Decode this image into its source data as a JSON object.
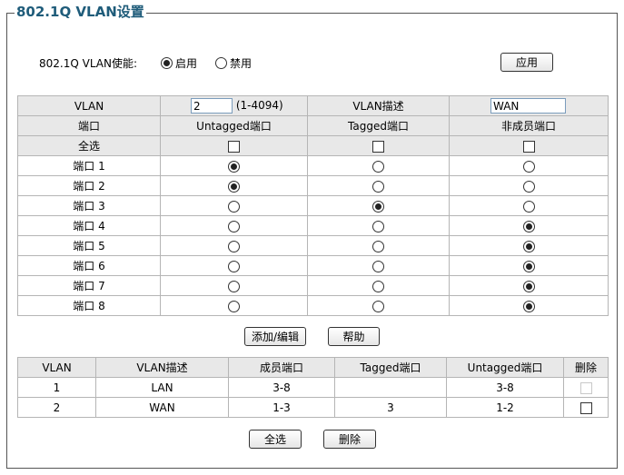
{
  "title": "802.1Q VLAN设置",
  "enable": {
    "label": "802.1Q VLAN使能:",
    "on_label": "启用",
    "off_label": "禁用",
    "selected": "on"
  },
  "apply_label": "应用",
  "config": {
    "vlan_label": "VLAN",
    "vlan_value": "2",
    "vlan_range": "(1-4094)",
    "desc_label": "VLAN描述",
    "desc_value": "WAN",
    "headers": [
      "端口",
      "Untagged端口",
      "Tagged端口",
      "非成员端口"
    ],
    "select_all_label": "全选",
    "ports": [
      {
        "name": "端口 1",
        "mode": "untagged"
      },
      {
        "name": "端口 2",
        "mode": "untagged"
      },
      {
        "name": "端口 3",
        "mode": "tagged"
      },
      {
        "name": "端口 4",
        "mode": "nonmember"
      },
      {
        "name": "端口 5",
        "mode": "nonmember"
      },
      {
        "name": "端口 6",
        "mode": "nonmember"
      },
      {
        "name": "端口 7",
        "mode": "nonmember"
      },
      {
        "name": "端口 8",
        "mode": "nonmember"
      }
    ]
  },
  "add_edit_label": "添加/编辑",
  "help_label": "帮助",
  "list": {
    "headers": [
      "VLAN",
      "VLAN描述",
      "成员端口",
      "Tagged端口",
      "Untagged端口",
      "删除"
    ],
    "rows": [
      {
        "vlan": "1",
        "desc": "LAN",
        "members": "3-8",
        "tagged": "",
        "untagged": "3-8",
        "deletable": false
      },
      {
        "vlan": "2",
        "desc": "WAN",
        "members": "1-3",
        "tagged": "3",
        "untagged": "1-2",
        "deletable": true
      }
    ]
  },
  "select_all_button_label": "全选",
  "delete_button_label": "删除"
}
